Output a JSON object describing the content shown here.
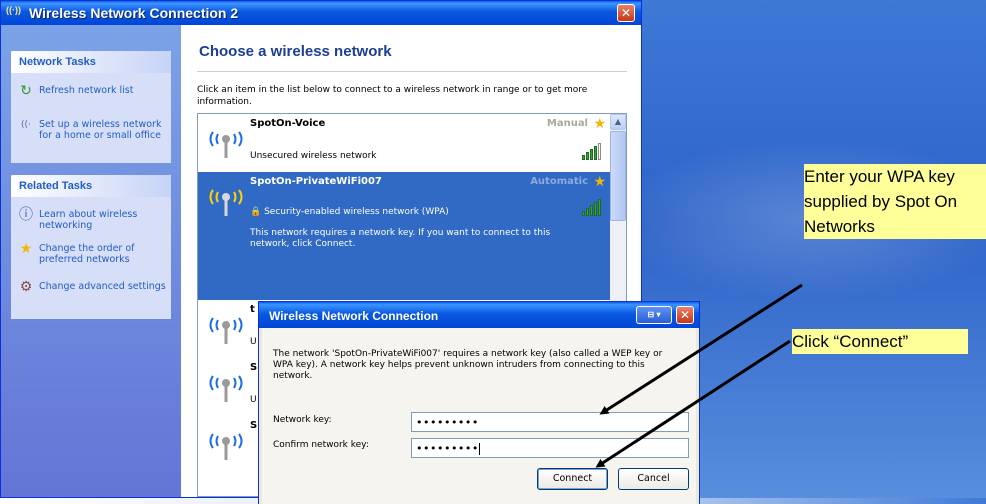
{
  "window": {
    "title": "Wireless Network Connection 2",
    "icon": "wireless-signal-icon",
    "icon_glyph": "((·))",
    "close_glyph": "✕"
  },
  "sidebar": {
    "network_tasks": {
      "header": "Network Tasks",
      "items": [
        {
          "label": "Refresh network list",
          "icon": "refresh-icon",
          "glyph": "↻"
        },
        {
          "label": "Set up a wireless network for a home or small office",
          "icon": "setup-wizard-icon",
          "glyph": "((·"
        }
      ]
    },
    "related_tasks": {
      "header": "Related Tasks",
      "items": [
        {
          "label": "Learn about wireless networking",
          "icon": "info-icon",
          "glyph": "ⓘ"
        },
        {
          "label": "Change the order of preferred networks",
          "icon": "star-icon",
          "glyph": "★"
        },
        {
          "label": "Change advanced settings",
          "icon": "settings-icon",
          "glyph": "⚙"
        }
      ]
    }
  },
  "main": {
    "heading": "Choose a wireless network",
    "instructions": "Click an item in the list below to connect to a wireless network in range or to get more information.",
    "networks": [
      {
        "name": "SpotOn-Voice",
        "mode": "Manual",
        "status": "Unsecured wireless network",
        "selected": false,
        "signal": 4
      },
      {
        "name": "SpotOn-PrivateWiFi007",
        "mode": "Automatic",
        "status": "Security-enabled wireless network (WPA)",
        "selected": true,
        "signal": 5,
        "message": "This network requires a network key. If you want to connect to this network, click Connect."
      },
      {
        "name": "t",
        "status": "U"
      },
      {
        "name": "S",
        "status": "U"
      },
      {
        "name": "S",
        "status": ""
      }
    ],
    "star_glyph": "★",
    "lock_glyph": "🔒",
    "scroll_up_glyph": "▲"
  },
  "dialog": {
    "title": "Wireless Network Connection",
    "message": "The network 'SpotOn-PrivateWiFi007' requires a network key (also called a WEP key or WPA key). A network key helps prevent unknown intruders from connecting to this network.",
    "network_key_label": "Network key:",
    "network_key_value": "•••••••••",
    "confirm_key_label": "Confirm network key:",
    "confirm_key_value": "•••••••••",
    "connect_label": "Connect",
    "cancel_label": "Cancel",
    "help_glyph": "⊟ ▾",
    "close_glyph": "✕"
  },
  "callouts": {
    "wpa_key": "Enter your WPA key supplied by Spot On Networks",
    "click_connect": "Click “Connect”"
  },
  "colors": {
    "selection": "#316ac5",
    "titlebar": "#0a58e0",
    "callout_bg": "#ffff99",
    "sidebar_link": "#215dc6"
  }
}
